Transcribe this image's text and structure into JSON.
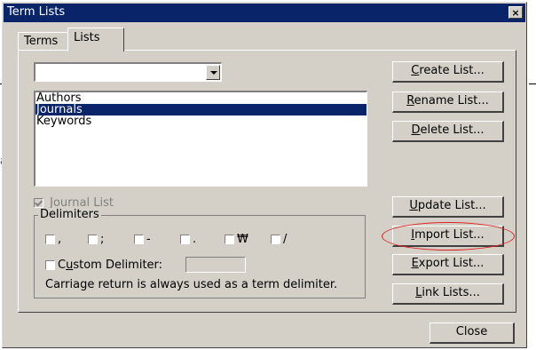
{
  "window": {
    "title": "Term Lists",
    "close_glyph": "×"
  },
  "tabs": [
    {
      "label": "Terms"
    },
    {
      "label": "Lists"
    }
  ],
  "list_select": {
    "value": ""
  },
  "lists": {
    "items": [
      "Authors",
      "Journals",
      "Keywords"
    ],
    "selected_index": 1
  },
  "journal_list": {
    "label": "Journal List",
    "checked": true,
    "disabled": true
  },
  "delimiters": {
    "label": "Delimiters",
    "options": [
      ",",
      ";",
      "-",
      ".",
      "₩",
      "/"
    ],
    "custom_label_pre": "C",
    "custom_label_u": "u",
    "custom_label_post": "stom Delimiter:",
    "custom_value": "",
    "note": "Carriage return is always used as a term delimiter."
  },
  "buttons": {
    "create": {
      "u": "C",
      "rest": "reate List..."
    },
    "rename": {
      "u": "R",
      "rest": "ename List..."
    },
    "delete": {
      "u": "D",
      "rest": "elete List..."
    },
    "update": {
      "u": "U",
      "rest": "pdate List..."
    },
    "import": {
      "u": "I",
      "rest": "mport List..."
    },
    "export": {
      "u": "E",
      "rest": "xport List..."
    },
    "link": {
      "u": "L",
      "rest": "ink Lists..."
    },
    "close": "Close"
  },
  "colors": {
    "dialog_bg": "#d4d0c8",
    "titlebar": "#0a246a",
    "selection": "#0a246a",
    "highlight_ring": "#e02020"
  }
}
